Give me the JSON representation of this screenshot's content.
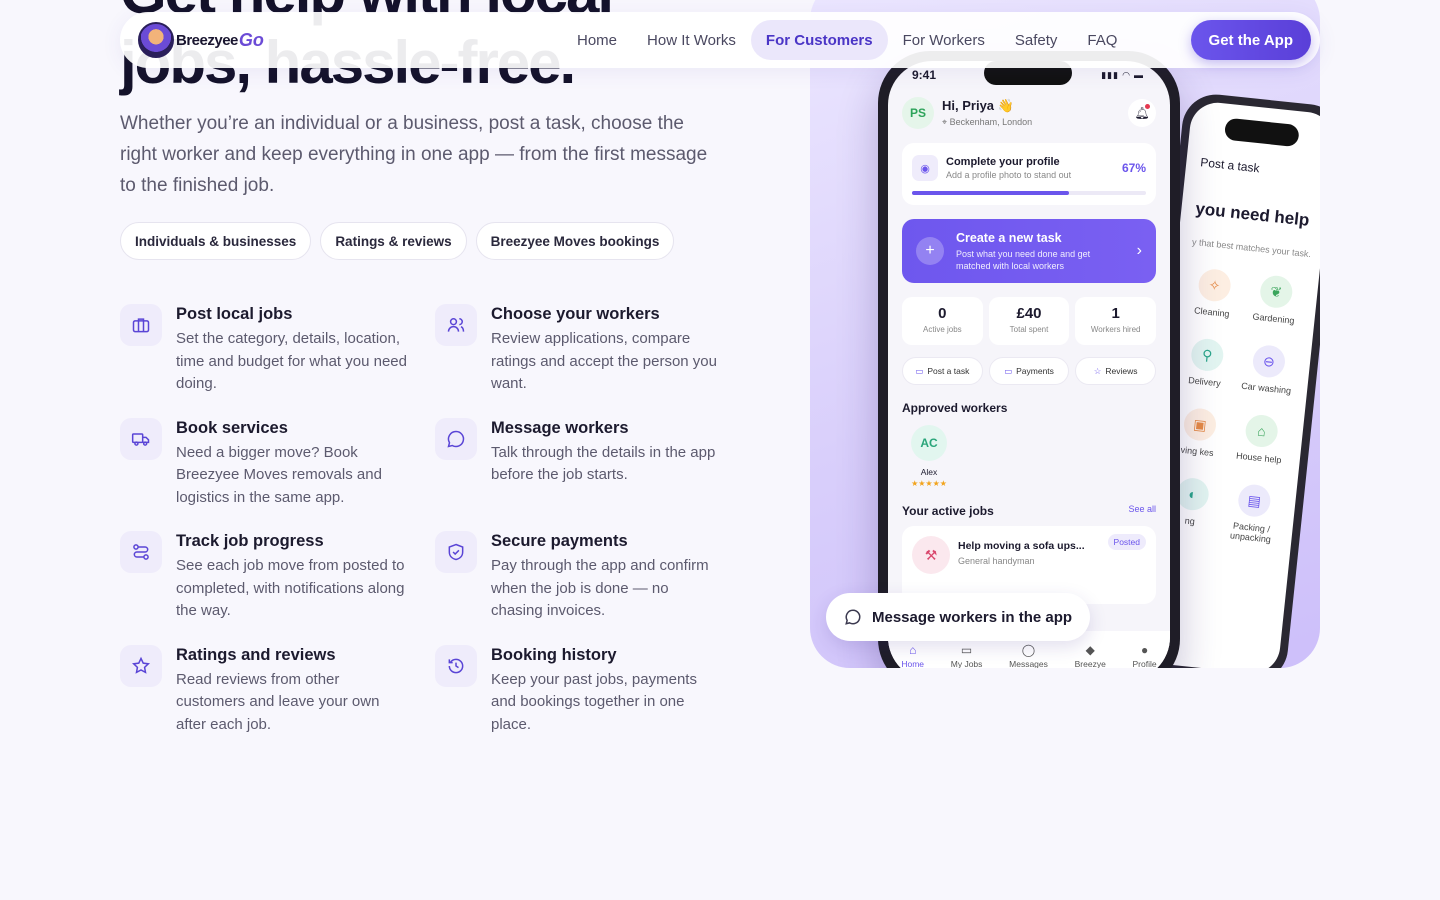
{
  "nav": {
    "brand": "Breezyee",
    "brand_go": "Go",
    "links": [
      "Home",
      "How It Works",
      "For Customers",
      "For Workers",
      "Safety",
      "FAQ"
    ],
    "active": "For Customers",
    "cta": "Get the App"
  },
  "hero": {
    "title": "Get help with local jobs, hassle-free.",
    "subtitle": "Whether you’re an individual or a business, post a task, choose the right worker and keep everything in one app — from the first message to the finished job.",
    "chips": [
      "Individuals & businesses",
      "Ratings & reviews",
      "Breezyee Moves bookings"
    ]
  },
  "features": [
    {
      "icon": "briefcase-icon",
      "title": "Post local jobs",
      "text": "Set the category, details, location, time and budget for what you need doing."
    },
    {
      "icon": "users-icon",
      "title": "Choose your workers",
      "text": "Review applications, compare ratings and accept the person you want."
    },
    {
      "icon": "truck-icon",
      "title": "Book services",
      "text": "Need a bigger move? Book Breezyee Moves removals and logistics in the same app."
    },
    {
      "icon": "message-icon",
      "title": "Message workers",
      "text": "Talk through the details in the app before the job starts."
    },
    {
      "icon": "route-icon",
      "title": "Track job progress",
      "text": "See each job move from posted to completed, with notifications along the way."
    },
    {
      "icon": "shield-check-icon",
      "title": "Secure payments",
      "text": "Pay through the app and confirm when the job is done — no chasing invoices."
    },
    {
      "icon": "star-icon",
      "title": "Ratings and reviews",
      "text": "Read reviews from other customers and leave your own after each job."
    },
    {
      "icon": "history-icon",
      "title": "Booking history",
      "text": "Keep your past jobs, payments and bookings together in one place."
    }
  ],
  "phone": {
    "time": "9:41",
    "initials": "PS",
    "greeting": "Hi, Priya 👋",
    "location": "Beckenham, London",
    "profile_title": "Complete your profile",
    "profile_sub": "Add a profile photo to stand out",
    "profile_pct": "67%",
    "profile_progress": 0.67,
    "create_title": "Create a new task",
    "create_sub": "Post what you need done and get matched with local workers",
    "stats": [
      {
        "value": "0",
        "label": "Active jobs"
      },
      {
        "value": "£40",
        "label": "Total spent"
      },
      {
        "value": "1",
        "label": "Workers hired"
      }
    ],
    "quick": [
      "Post a task",
      "Payments",
      "Reviews"
    ],
    "approved_heading": "Approved workers",
    "worker_initials": "AC",
    "worker_name": "Alex",
    "worker_stars": "★★★★★",
    "active_heading": "Your active jobs",
    "see_all": "See all",
    "job_title": "Help moving a sofa ups...",
    "job_sub": "General handyman",
    "job_status": "Posted",
    "tabs": [
      "Home",
      "My Jobs",
      "Messages",
      "Breezye",
      "Profile"
    ]
  },
  "back_phone": {
    "title": "Post a task",
    "heading": "you need help",
    "hint": "y that best matches your task.",
    "categories": [
      "Cleaning",
      "Gardening",
      "Delivery",
      "Car washing",
      "ving kes",
      "House help",
      "ng",
      "Packing / unpacking"
    ]
  },
  "message_pill": "Message workers in the app",
  "colors": {
    "accent": "#6b55ec",
    "background": "#f8f7fd"
  }
}
